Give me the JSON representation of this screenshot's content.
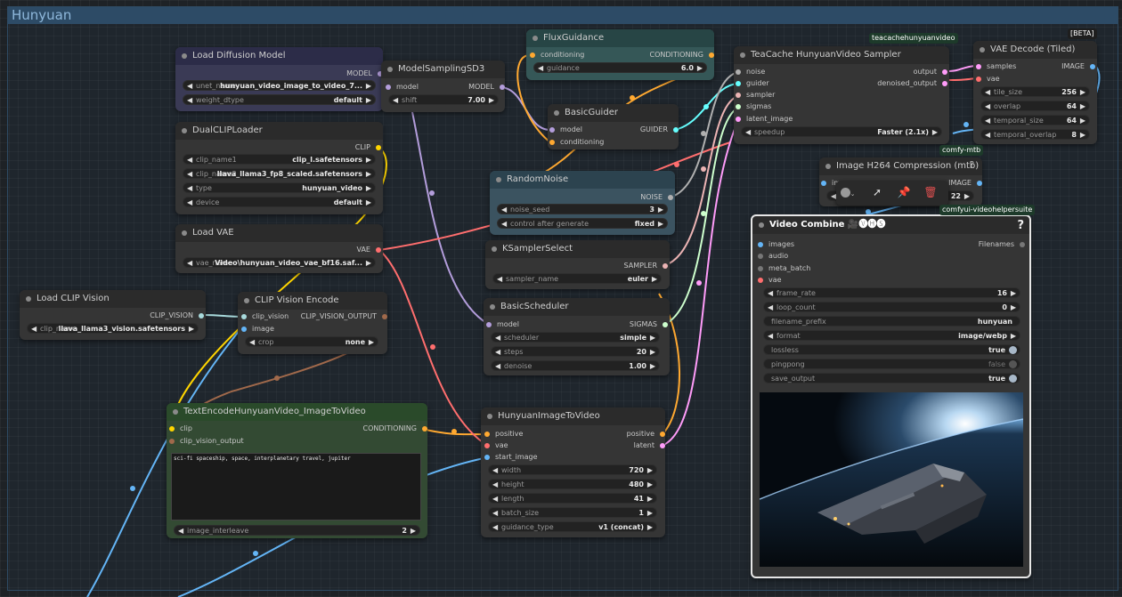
{
  "group": {
    "title": "Hunyuan"
  },
  "nodes": {
    "load_diffusion_model": {
      "title": "Load Diffusion Model",
      "output": "MODEL",
      "widgets": [
        {
          "label": "unet_name",
          "value": "hunyuan_video_image_to_video_7..."
        },
        {
          "label": "weight_dtype",
          "value": "default"
        }
      ]
    },
    "model_sampling_sd3": {
      "title": "ModelSamplingSD3",
      "input": "model",
      "output": "MODEL",
      "widgets": [
        {
          "label": "shift",
          "value": "7.00"
        }
      ]
    },
    "flux_guidance": {
      "title": "FluxGuidance",
      "input": "conditioning",
      "output": "CONDITIONING",
      "widgets": [
        {
          "label": "guidance",
          "value": "6.0"
        }
      ]
    },
    "basic_guider": {
      "title": "BasicGuider",
      "inputs": [
        "model",
        "conditioning"
      ],
      "output": "GUIDER"
    },
    "dual_clip_loader": {
      "title": "DualCLIPLoader",
      "output": "CLIP",
      "widgets": [
        {
          "label": "clip_name1",
          "value": "clip_l.safetensors"
        },
        {
          "label": "clip_name2",
          "value": "llava_llama3_fp8_scaled.safetensors"
        },
        {
          "label": "type",
          "value": "hunyuan_video"
        },
        {
          "label": "device",
          "value": "default"
        }
      ]
    },
    "random_noise": {
      "title": "RandomNoise",
      "output": "NOISE",
      "widgets": [
        {
          "label": "noise_seed",
          "value": "3"
        },
        {
          "label": "control after generate",
          "value": "fixed"
        }
      ]
    },
    "load_vae": {
      "title": "Load VAE",
      "output": "VAE",
      "widgets": [
        {
          "label": "vae_name",
          "value": "Video\\hunyuan_video_vae_bf16.saf..."
        }
      ]
    },
    "ksampler_select": {
      "title": "KSamplerSelect",
      "output": "SAMPLER",
      "widgets": [
        {
          "label": "sampler_name",
          "value": "euler"
        }
      ]
    },
    "load_clip_vision": {
      "title": "Load CLIP Vision",
      "output": "CLIP_VISION",
      "widgets": [
        {
          "label": "clip_name",
          "value": "llava_llama3_vision.safetensors"
        }
      ]
    },
    "clip_vision_encode": {
      "title": "CLIP Vision Encode",
      "inputs": [
        "clip_vision",
        "image"
      ],
      "output": "CLIP_VISION_OUTPUT",
      "widgets": [
        {
          "label": "crop",
          "value": "none"
        }
      ]
    },
    "basic_scheduler": {
      "title": "BasicScheduler",
      "input": "model",
      "output": "SIGMAS",
      "widgets": [
        {
          "label": "scheduler",
          "value": "simple"
        },
        {
          "label": "steps",
          "value": "20"
        },
        {
          "label": "denoise",
          "value": "1.00"
        }
      ]
    },
    "text_encode": {
      "title": "TextEncodeHunyuanVideo_ImageToVideo",
      "inputs": [
        "clip",
        "clip_vision_output"
      ],
      "output": "CONDITIONING",
      "prompt": "sci-fi spaceship, space, interplanetary travel, jupiter",
      "widgets": [
        {
          "label": "image_interleave",
          "value": "2"
        }
      ]
    },
    "hunyuan_i2v": {
      "title": "HunyuanImageToVideo",
      "inputs": [
        "positive",
        "vae",
        "start_image"
      ],
      "outputs": [
        "positive",
        "latent"
      ],
      "widgets": [
        {
          "label": "width",
          "value": "720"
        },
        {
          "label": "height",
          "value": "480"
        },
        {
          "label": "length",
          "value": "41"
        },
        {
          "label": "batch_size",
          "value": "1"
        },
        {
          "label": "guidance_type",
          "value": "v1 (concat)"
        }
      ]
    },
    "teacache_sampler": {
      "title": "TeaCache HunyuanVideo Sampler",
      "badge": "teacachehunyuanvideo",
      "inputs": [
        "noise",
        "guider",
        "sampler",
        "sigmas",
        "latent_image"
      ],
      "outputs": [
        "output",
        "denoised_output"
      ],
      "widgets": [
        {
          "label": "speedup",
          "value": "Faster (2.1x)"
        }
      ]
    },
    "vae_decode": {
      "title": "VAE Decode (Tiled)",
      "badge": "[BETA]",
      "inputs": [
        "samples",
        "vae"
      ],
      "output": "IMAGE",
      "widgets": [
        {
          "label": "tile_size",
          "value": "256"
        },
        {
          "label": "overlap",
          "value": "64"
        },
        {
          "label": "temporal_size",
          "value": "64"
        },
        {
          "label": "temporal_overlap",
          "value": "8"
        }
      ]
    },
    "image_h264": {
      "title": "Image H264 Compression (mtb)",
      "badge": "comfy-mtb",
      "input": "im",
      "output": "IMAGE",
      "widget_value": "22",
      "help": "?"
    },
    "video_combine": {
      "title": "Video Combine 🎥🅥🅗🅢",
      "badge": "comfyui-videohelpersuite",
      "help": "?",
      "inputs": [
        "images",
        "audio",
        "meta_batch",
        "vae"
      ],
      "output": "Filenames",
      "widgets": [
        {
          "label": "frame_rate",
          "value": "16"
        },
        {
          "label": "loop_count",
          "value": "0"
        },
        {
          "label": "filename_prefix",
          "value": "hunyuan"
        },
        {
          "label": "format",
          "value": "image/webp"
        }
      ],
      "toggles": [
        {
          "label": "lossless",
          "value": "true",
          "on": true
        },
        {
          "label": "pingpong",
          "value": "false",
          "on": false
        },
        {
          "label": "save_output",
          "value": "true",
          "on": true
        }
      ]
    }
  },
  "toolbar": {
    "icons": [
      "color-circle-icon",
      "bypass-icon",
      "pin-icon",
      "trash-icon"
    ]
  },
  "colors": {
    "model": "#b39ddb",
    "clip": "#ffd500",
    "vae": "#ff6e6e",
    "conditioning": "#ffa931",
    "latent": "#ff9cf9",
    "image": "#64b5f6",
    "noise": "#b0b0b0",
    "sigmas": "#cdffcd",
    "sampler": "#ecb4b4",
    "guider": "#66ffff",
    "clip_vision": "#a8dadc"
  }
}
